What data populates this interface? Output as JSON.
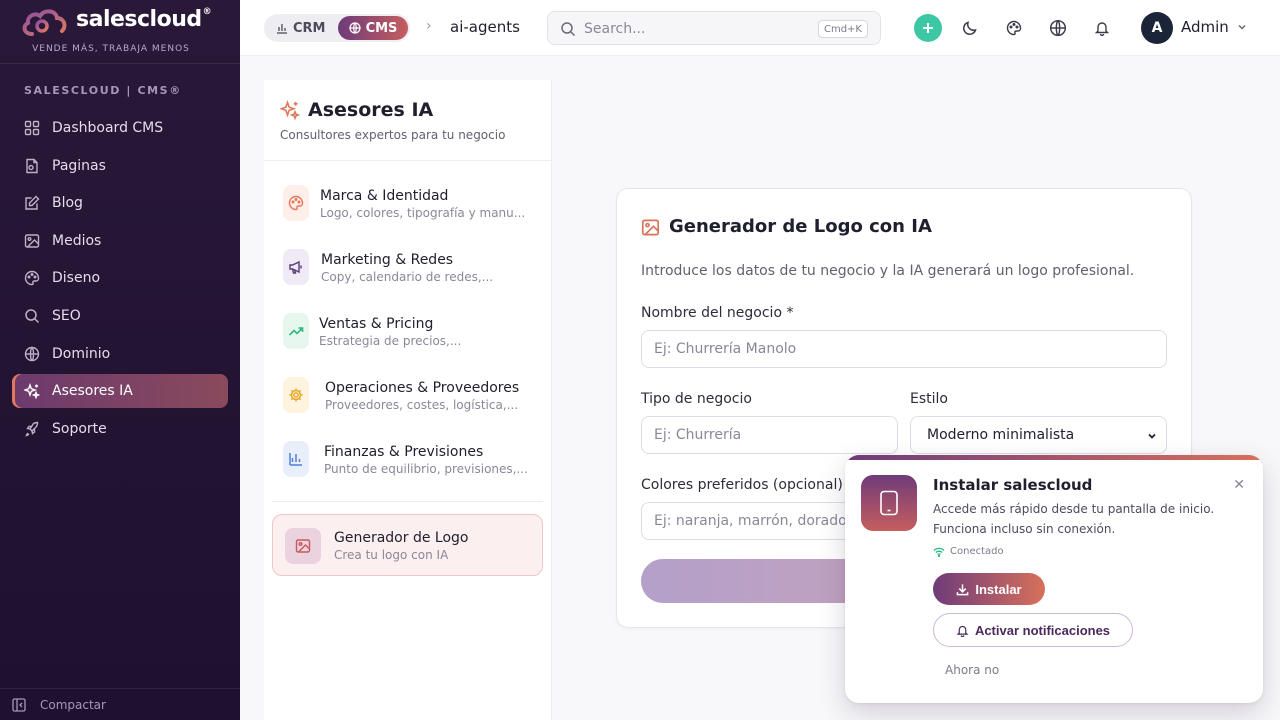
{
  "brand": {
    "name": "salescloud",
    "mark": "®",
    "tagline": "VENDE MÁS, TRABAJA MENOS"
  },
  "sidebar": {
    "section_label": "SALESCLOUD | CMS®",
    "items": [
      {
        "label": "Dashboard CMS",
        "icon": "grid-icon"
      },
      {
        "label": "Paginas",
        "icon": "file-icon"
      },
      {
        "label": "Blog",
        "icon": "edit-icon"
      },
      {
        "label": "Medios",
        "icon": "image-icon"
      },
      {
        "label": "Diseno",
        "icon": "palette-icon"
      },
      {
        "label": "SEO",
        "icon": "search-icon"
      },
      {
        "label": "Dominio",
        "icon": "globe-icon"
      },
      {
        "label": "Asesores IA",
        "icon": "sparkles-icon",
        "active": true
      },
      {
        "label": "Soporte",
        "icon": "rocket-icon"
      }
    ],
    "compact_label": "Compactar"
  },
  "topbar": {
    "crm_label": "CRM",
    "cms_label": "CMS",
    "breadcrumb_sep": "›",
    "breadcrumb": "ai-agents",
    "search_placeholder": "Search...",
    "search_shortcut": "Cmd+K",
    "add_label": "+",
    "user_initial": "A",
    "user_name": "Admin"
  },
  "advisors": {
    "title": "Asesores IA",
    "subtitle": "Consultores expertos para tu negocio",
    "items": [
      {
        "label": "Marca & Identidad",
        "desc": "Logo, colores, tipografía y manu...",
        "color": "#e8765a",
        "bg": "#fdeee9"
      },
      {
        "label": "Marketing & Redes",
        "desc": "Copy, calendario de redes,...",
        "color": "#5b3a7a",
        "bg": "#efeaf5"
      },
      {
        "label": "Ventas & Pricing",
        "desc": "Estrategia de precios,...",
        "color": "#2eb87e",
        "bg": "#e6f7ef"
      },
      {
        "label": "Operaciones & Proveedores",
        "desc": "Proveedores, costes, logística,...",
        "color": "#e5a51e",
        "bg": "#fdf3df"
      },
      {
        "label": "Finanzas & Previsiones",
        "desc": "Punto de equilibrio, previsiones,...",
        "color": "#4a80d8",
        "bg": "#e8eefa"
      }
    ],
    "logo_tool": {
      "label": "Generador de Logo",
      "desc": "Crea tu logo con IA"
    }
  },
  "form": {
    "title": "Generador de Logo con IA",
    "description": "Introduce los datos de tu negocio y la IA generará un logo profesional.",
    "business_name_label": "Nombre del negocio *",
    "business_name_placeholder": "Ej: Churrería Manolo",
    "business_type_label": "Tipo de negocio",
    "business_type_placeholder": "Ej: Churrería",
    "style_label": "Estilo",
    "style_value": "Moderno minimalista",
    "colors_label": "Colores preferidos (opcional)",
    "colors_placeholder": "Ej: naranja, marrón, dorado"
  },
  "install": {
    "title": "Instalar salescloud",
    "close": "✕",
    "description": "Accede más rápido desde tu pantalla de inicio. Funciona incluso sin conexión.",
    "status": "Conectado",
    "install_label": "Instalar",
    "notif_label": "Activar notificaciones",
    "later_label": "Ahora no"
  },
  "colors": {
    "accent_purple": "#6e3b7a",
    "accent_coral": "#d8705a",
    "success": "#3cc8a4"
  }
}
